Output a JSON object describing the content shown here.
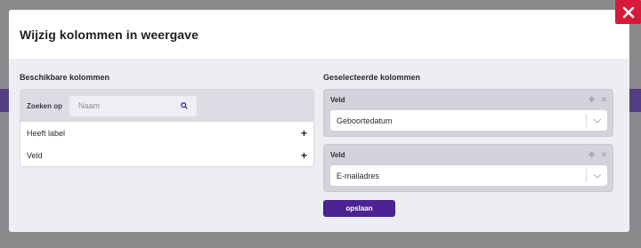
{
  "dialog": {
    "title": "Wijzig kolommen in weergave"
  },
  "close": {
    "icon": "close-icon",
    "color": "#d7193a"
  },
  "available": {
    "title": "Beschikbare kolommen",
    "search_label": "Zoeken op",
    "search_placeholder": "Naam",
    "search_value": "",
    "items": [
      {
        "label": "Heeft label",
        "icon": "plus-icon"
      },
      {
        "label": "Veld",
        "icon": "plus-icon"
      }
    ]
  },
  "selected": {
    "title": "Geselecteerde kolommen",
    "cards": [
      {
        "label": "Veld",
        "value": "Geboortedatum"
      },
      {
        "label": "Veld",
        "value": "E-mailadres"
      }
    ]
  },
  "save_label": "opslaan",
  "colors": {
    "accent": "#4c2390",
    "close": "#d7193a"
  }
}
